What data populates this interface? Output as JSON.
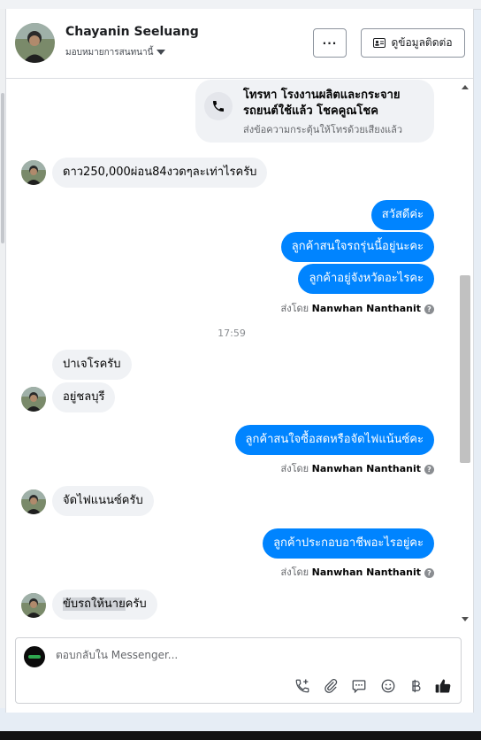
{
  "header": {
    "name": "Chayanin Seeluang",
    "assign_label": "มอบหมายการสนทนานี้",
    "more_label": "···",
    "contact_label": "ดูข้อมูลติดต่อ"
  },
  "call_card": {
    "title": "โทรหา โรงงานผลิตและกระจายรถยนต์ใช้แล้ว โชคคูณโชค",
    "subtitle": "ส่งข้อความกระตุ้นให้โทรด้วยเสียงแล้ว"
  },
  "messages": {
    "m1": "ดาว250,000ผ่อน84งวดๆละเท่าไรครับ",
    "m2": "สวัสดีค่ะ",
    "m3": "ลูกค้าสนใจรถรุ่นนี้อยู่นะคะ",
    "m4": "ลูกค้าอยู่จังหวัดอะไรคะ",
    "m5": "ปาเจโรครับ",
    "m6": "อยู่ชลบุรี",
    "m7": "ลูกค้าสนใจซื้อสดหรือจัดไฟแน้นซ์คะ",
    "m8": "จัดไฟแนนซ์ครับ",
    "m9": "ลูกค้าประกอบอาชีพอะไรอยู่คะ",
    "m10_highlight": "ขับรถให้นาย",
    "m10_rest": "ครับ"
  },
  "sent_by": {
    "prefix": "ส่งโดย",
    "agent": "Nanwhan Nanthanit"
  },
  "timestamp": "17:59",
  "composer": {
    "placeholder": "ตอบกลับใน Messenger..."
  },
  "icons": {
    "call": "phone-icon",
    "contact_card": "contact-card-icon",
    "info": "info-icon",
    "add_call": "add-call-icon",
    "attach": "paperclip-icon",
    "quick_reply": "message-bubble-icon",
    "emoji": "emoji-icon",
    "currency": "baht-icon",
    "like": "thumbs-up-icon"
  },
  "colors": {
    "outgoing_bubble": "#0084ff",
    "incoming_bubble": "#f0f2f5",
    "like_icon": "#1c1e21"
  }
}
